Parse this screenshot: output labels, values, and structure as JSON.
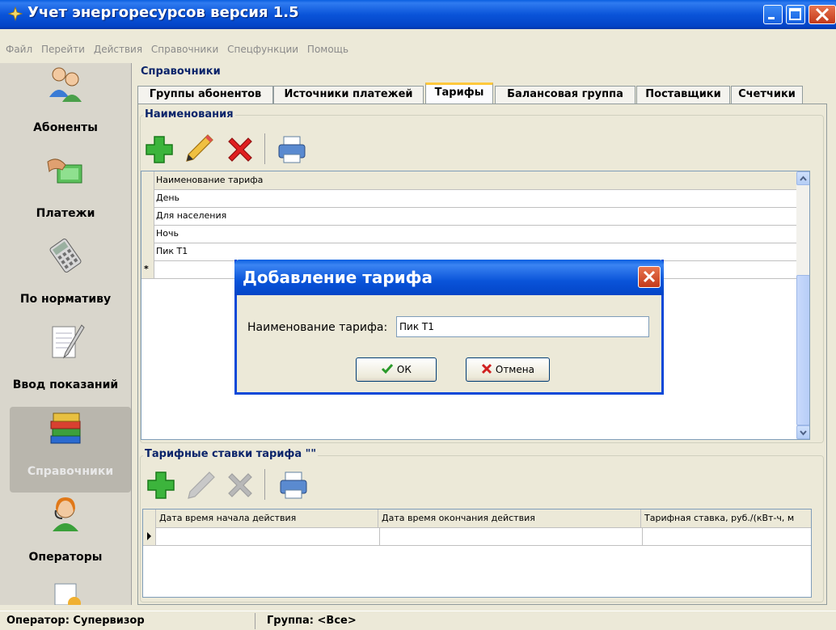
{
  "window": {
    "title": "Учет энергоресурсов версия 1.5"
  },
  "menu": [
    "Файл",
    "Перейти",
    "Действия",
    "Справочники",
    "Спецфункции",
    "Помощь"
  ],
  "sidebar": {
    "items": [
      {
        "label": "Абоненты",
        "icon": "users-icon"
      },
      {
        "label": "Платежи",
        "icon": "payment-hand-icon"
      },
      {
        "label": "По нормативу",
        "icon": "calculator-icon"
      },
      {
        "label": "Ввод показаний",
        "icon": "notepad-pencil-icon"
      },
      {
        "label": "Справочники",
        "icon": "books-icon",
        "active": true
      },
      {
        "label": "Операторы",
        "icon": "operator-headset-icon"
      }
    ]
  },
  "main": {
    "section_title": "Справочники",
    "tabs": [
      "Группы абонентов",
      "Источники платежей",
      "Тарифы",
      "Балансовая группа",
      "Поставщики",
      "Счетчики"
    ],
    "active_tab": "Тарифы"
  },
  "names_group": {
    "legend": "Наименования",
    "grid": {
      "header": "Наименование тарифа",
      "rows": [
        "День",
        "Для населения",
        "Ночь",
        "Пик Т1"
      ],
      "new_row_marker": "*"
    }
  },
  "rates_group": {
    "legend": "Тарифные ставки тарифа \"\"",
    "grid": {
      "columns": [
        "Дата время начала действия",
        "Дата время окончания действия",
        "Тарифная ставка, руб./(кВт-ч, м"
      ]
    }
  },
  "dialog": {
    "title": "Добавление тарифа",
    "field_label": "Наименование тарифа:",
    "field_value": "Пик Т1",
    "ok_label": "ОК",
    "cancel_label": "Отмена"
  },
  "status": {
    "operator": "Оператор: Супервизор",
    "group": "Группа: <Все>"
  },
  "colors": {
    "title_bar": "#0a54d9",
    "legend_text": "#0a246a",
    "active_tab_accent": "#ffc83c"
  }
}
